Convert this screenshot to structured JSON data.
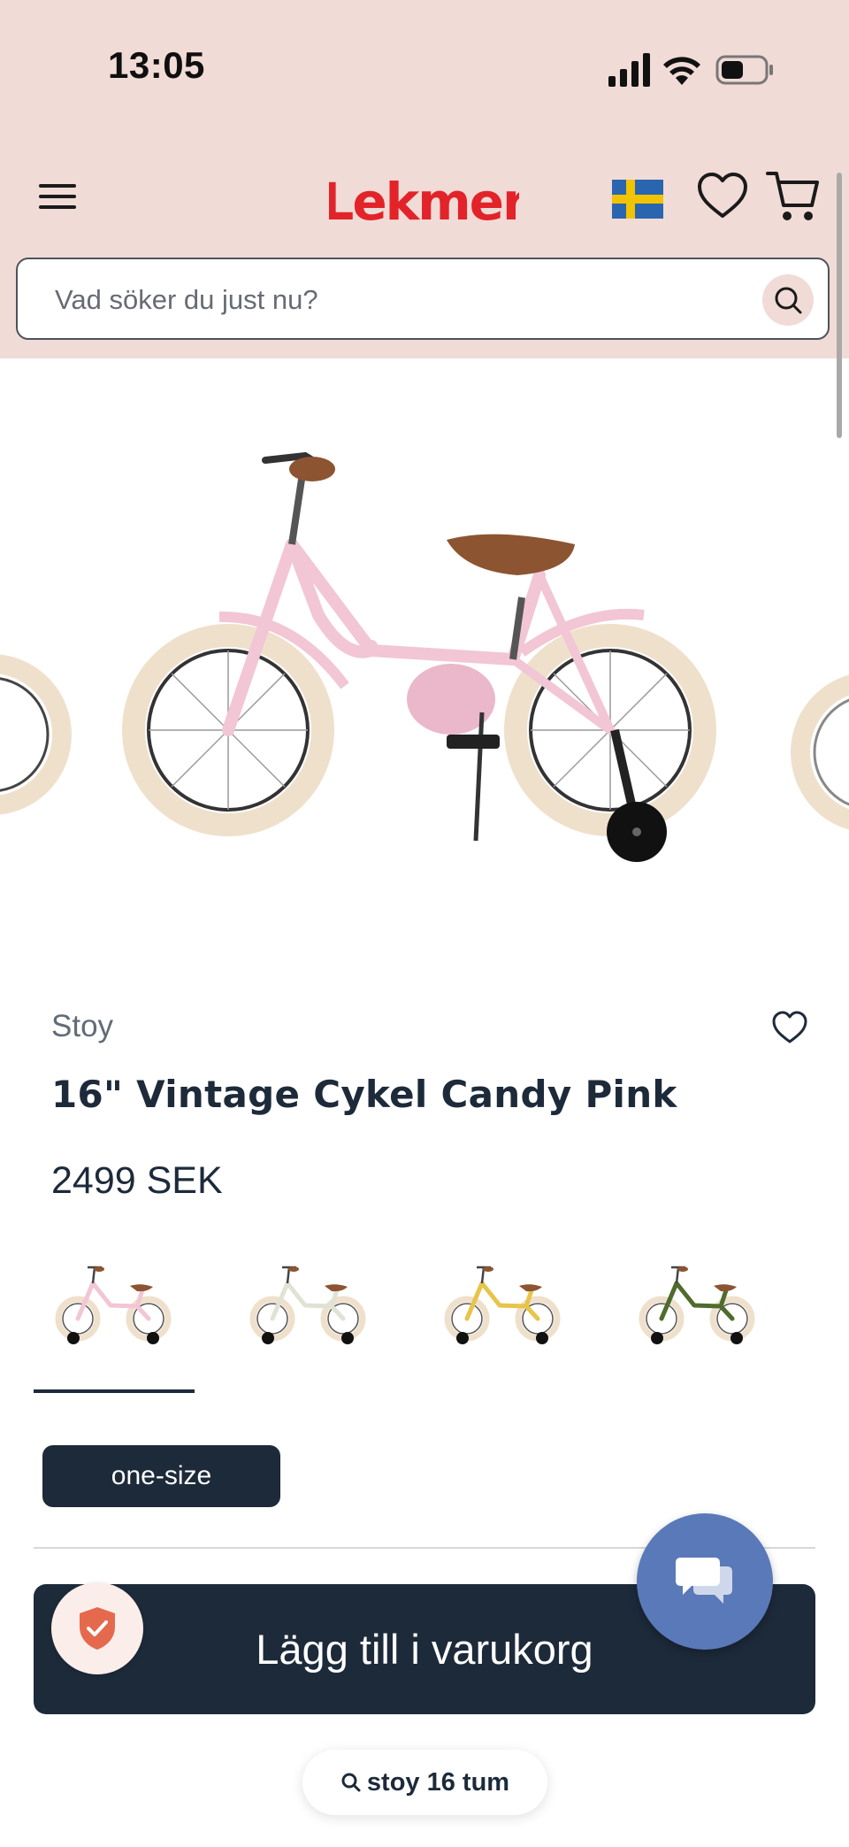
{
  "status_bar": {
    "time": "13:05"
  },
  "header": {
    "brand_logo": "Lekmer"
  },
  "search": {
    "placeholder": "Vad söker du just nu?"
  },
  "product": {
    "brand": "Stoy",
    "title": "16\" Vintage Cykel Candy Pink",
    "price": "2499 SEK",
    "size": "one-size"
  },
  "variants": [
    {
      "frame_color": "#f2c6d4",
      "selected": true
    },
    {
      "frame_color": "#dfe3d4",
      "selected": false
    },
    {
      "frame_color": "#e7c44a",
      "selected": false
    },
    {
      "frame_color": "#4f6b2e",
      "selected": false
    }
  ],
  "actions": {
    "add_to_cart": "Lägg till i varukorg"
  },
  "bottom_search": {
    "label": "stoy 16 tum"
  },
  "colors": {
    "header_bg": "#f1dbd6",
    "navy": "#1d2a3a",
    "brand_red": "#e2232a",
    "chat_blue": "#5a79b8"
  }
}
